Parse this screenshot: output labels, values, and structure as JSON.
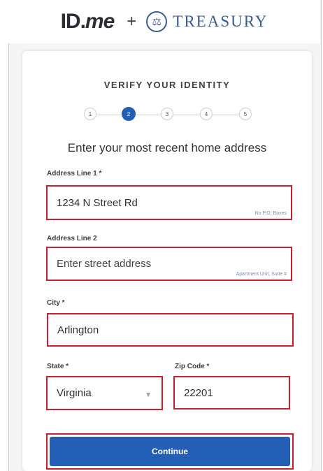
{
  "header": {
    "logo_id": "ID",
    "logo_me": "me",
    "plus": "+",
    "treasury": "TREASURY",
    "seal_icon": "treasury-seal-icon"
  },
  "form": {
    "title": "VERIFY YOUR IDENTITY",
    "steps": [
      "1",
      "2",
      "3",
      "4",
      "5"
    ],
    "active_step": "2",
    "heading": "Enter your most recent home address",
    "address1": {
      "label": "Address Line 1 *",
      "value": "1234 N Street Rd",
      "hint": "No P.O. Boxes"
    },
    "address2": {
      "label": "Address Line 2",
      "placeholder": "Enter street address",
      "hint": "Apartment Unit, Suite #"
    },
    "city": {
      "label": "City *",
      "value": "Arlington"
    },
    "state": {
      "label": "State *",
      "value": "Virginia"
    },
    "zip": {
      "label": "Zip Code *",
      "value": "22201"
    },
    "continue_label": "Continue"
  },
  "colors": {
    "accent": "#2360b5",
    "highlight": "#c8202e",
    "treasury": "#3a5d8f"
  }
}
